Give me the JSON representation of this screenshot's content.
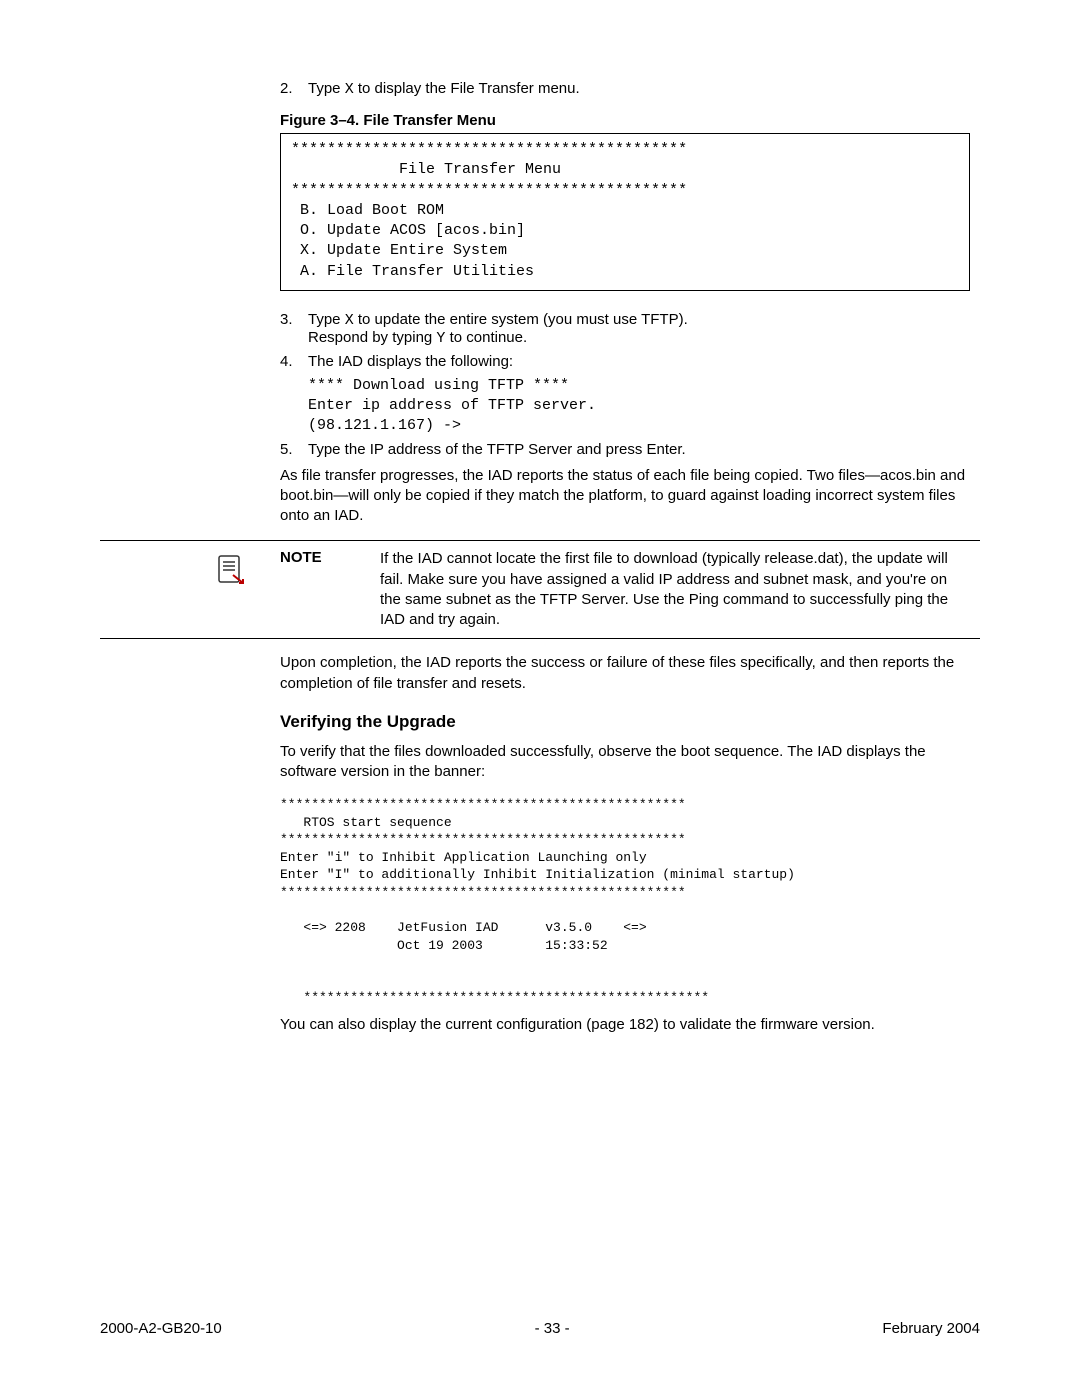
{
  "step2": {
    "num": "2.",
    "pre": "Type ",
    "key": "X",
    "post": " to display the File Transfer menu."
  },
  "figure34": {
    "caption": "Figure 3–4.  File Transfer Menu",
    "lines": "********************************************\n            File Transfer Menu\n********************************************\n B. Load Boot ROM\n O. Update ACOS [acos.bin]\n X. Update Entire System\n A. File Transfer Utilities"
  },
  "step3": {
    "num": "3.",
    "line1_pre": "Type ",
    "line1_key": "X",
    "line1_post": " to update the entire system (you must use TFTP).",
    "line2_pre": "Respond by typing ",
    "line2_key": "Y",
    "line2_post": " to continue."
  },
  "step4": {
    "num": "4.",
    "text": "The IAD displays the following:",
    "code": "**** Download using TFTP ****\nEnter ip address of TFTP server.\n(98.121.1.167) ->"
  },
  "step5": {
    "num": "5.",
    "text": "Type the IP address of the TFTP Server and press Enter."
  },
  "para_progress": "As file transfer progresses, the IAD reports the status of each file being copied. Two files—acos.bin and boot.bin—will only be copied if they match the platform, to guard against loading incorrect system files onto an IAD.",
  "note": {
    "label": "NOTE",
    "text": "If the IAD cannot locate the first file to download (typically release.dat), the update will fail. Make sure you have assigned a valid IP address and subnet mask, and you're on the same subnet as the TFTP Server. Use the Ping command to successfully ping the IAD and try again."
  },
  "para_completion": "Upon completion, the IAD reports the success or failure of these files specifically, and then reports the completion of file transfer and resets.",
  "verify": {
    "heading": "Verifying the Upgrade",
    "intro": "To verify that the files downloaded successfully, observe the boot sequence. The IAD displays the software version in the banner:",
    "boot": "****************************************************\n   RTOS start sequence\n****************************************************\nEnter \"i\" to Inhibit Application Launching only\nEnter \"I\" to additionally Inhibit Initialization (minimal startup)\n****************************************************\n\n   <=> 2208    JetFusion IAD      v3.5.0    <=>\n               Oct 19 2003        15:33:52\n\n\n   ****************************************************",
    "after_pre": "You can also display the current configuration (page ",
    "after_page": "182",
    "after_post": ") to validate the firmware version."
  },
  "footer": {
    "left": "2000-A2-GB20-10",
    "center": "- 33 -",
    "right": "February 2004"
  }
}
